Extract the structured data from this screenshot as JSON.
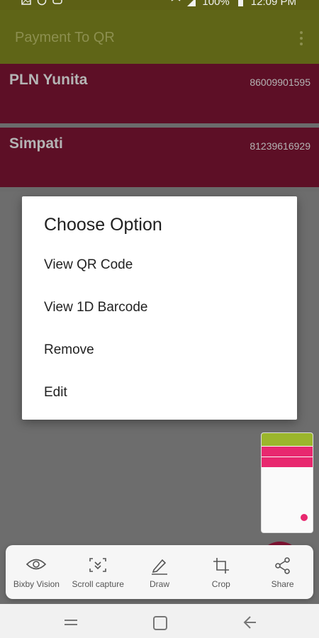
{
  "status_bar": {
    "battery": "100%",
    "time": "12:09 PM"
  },
  "app_bar": {
    "title": "Payment To QR"
  },
  "items": [
    {
      "name": "PLN Yunita",
      "number": "86009901595"
    },
    {
      "name": "Simpati",
      "number": "81239616929"
    }
  ],
  "dialog": {
    "title": "Choose Option",
    "options": [
      "View QR Code",
      "View 1D Barcode",
      "Remove",
      "Edit"
    ]
  },
  "toolbar": {
    "items": [
      {
        "label": "Bixby Vision",
        "icon": "eye-icon"
      },
      {
        "label": "Scroll capture",
        "icon": "scroll-capture-icon"
      },
      {
        "label": "Draw",
        "icon": "pencil-icon"
      },
      {
        "label": "Crop",
        "icon": "crop-icon"
      },
      {
        "label": "Share",
        "icon": "share-icon"
      }
    ]
  },
  "colors": {
    "app_bar": "#5f6517",
    "list_item": "#5d0f26",
    "overlay": "#6d6d6d",
    "fab": "#7f1232"
  }
}
